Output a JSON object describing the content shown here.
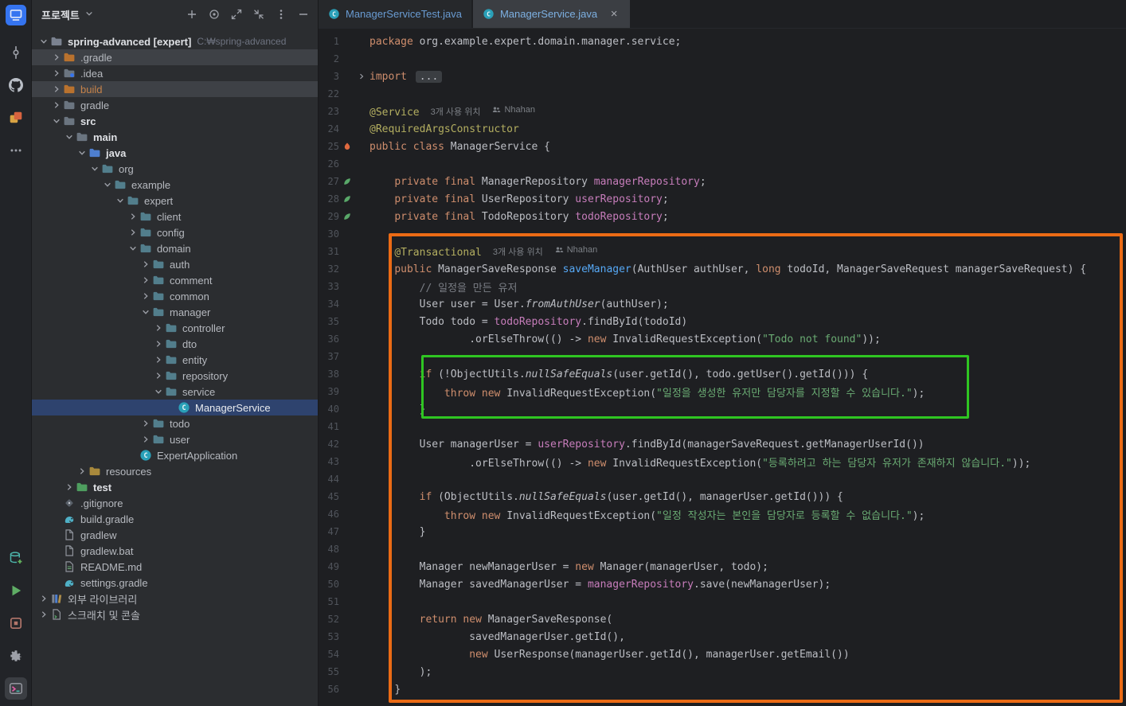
{
  "activity_bar": {
    "top": [
      {
        "name": "app-logo"
      },
      {
        "name": "commit"
      },
      {
        "name": "github"
      },
      {
        "name": "services"
      },
      {
        "name": "more"
      }
    ],
    "bottom": [
      {
        "name": "database-add"
      },
      {
        "name": "run"
      },
      {
        "name": "artifact"
      },
      {
        "name": "settings"
      },
      {
        "name": "terminal",
        "active": true
      }
    ]
  },
  "project_panel": {
    "title": "프로젝트",
    "header_icons": [
      {
        "name": "plus"
      },
      {
        "name": "target"
      },
      {
        "name": "expand"
      },
      {
        "name": "collapse"
      },
      {
        "name": "kebab"
      },
      {
        "name": "hide"
      }
    ],
    "tree": [
      {
        "label": "spring-advanced [expert]",
        "extra": "C:₩spring-advanced",
        "level": 0,
        "chevron": "down",
        "icon": "folder-root",
        "bold": true
      },
      {
        "label": ".gradle",
        "level": 1,
        "chevron": "right",
        "icon": "folder-excluded",
        "row": "hover"
      },
      {
        "label": ".idea",
        "level": 1,
        "chevron": "right",
        "icon": "folder-idea"
      },
      {
        "label": "build",
        "level": 1,
        "chevron": "right",
        "icon": "folder-excluded",
        "row": "hover",
        "label_class": "excluded"
      },
      {
        "label": "gradle",
        "level": 1,
        "chevron": "right",
        "icon": "folder"
      },
      {
        "label": "src",
        "level": 1,
        "chevron": "down",
        "icon": "folder",
        "bold": true
      },
      {
        "label": "main",
        "level": 2,
        "chevron": "down",
        "icon": "folder",
        "bold": true
      },
      {
        "label": "java",
        "level": 3,
        "chevron": "down",
        "icon": "folder-source",
        "bold": true
      },
      {
        "label": "org",
        "level": 4,
        "chevron": "down",
        "icon": "package"
      },
      {
        "label": "example",
        "level": 5,
        "chevron": "down",
        "icon": "package"
      },
      {
        "label": "expert",
        "level": 6,
        "chevron": "down",
        "icon": "package"
      },
      {
        "label": "client",
        "level": 7,
        "chevron": "right",
        "icon": "package"
      },
      {
        "label": "config",
        "level": 7,
        "chevron": "right",
        "icon": "package"
      },
      {
        "label": "domain",
        "level": 7,
        "chevron": "down",
        "icon": "package"
      },
      {
        "label": "auth",
        "level": 8,
        "chevron": "right",
        "icon": "package"
      },
      {
        "label": "comment",
        "level": 8,
        "chevron": "right",
        "icon": "package"
      },
      {
        "label": "common",
        "level": 8,
        "chevron": "right",
        "icon": "package"
      },
      {
        "label": "manager",
        "level": 8,
        "chevron": "down",
        "icon": "package"
      },
      {
        "label": "controller",
        "level": 9,
        "chevron": "right",
        "icon": "package"
      },
      {
        "label": "dto",
        "level": 9,
        "chevron": "right",
        "icon": "package"
      },
      {
        "label": "entity",
        "level": 9,
        "chevron": "right",
        "icon": "package"
      },
      {
        "label": "repository",
        "level": 9,
        "chevron": "right",
        "icon": "package"
      },
      {
        "label": "service",
        "level": 9,
        "chevron": "down",
        "icon": "package"
      },
      {
        "label": "ManagerService",
        "level": 10,
        "chevron": "none",
        "icon": "class",
        "selected": true
      },
      {
        "label": "todo",
        "level": 8,
        "chevron": "right",
        "icon": "package"
      },
      {
        "label": "user",
        "level": 8,
        "chevron": "right",
        "icon": "package"
      },
      {
        "label": "ExpertApplication",
        "level": 7,
        "chevron": "none",
        "icon": "class"
      },
      {
        "label": "resources",
        "level": 3,
        "chevron": "right",
        "icon": "folder-resources"
      },
      {
        "label": "test",
        "level": 2,
        "chevron": "right",
        "icon": "folder-test",
        "bold": true
      },
      {
        "label": ".gitignore",
        "level": 1,
        "chevron": "none",
        "icon": "gitignore"
      },
      {
        "label": "build.gradle",
        "level": 1,
        "chevron": "none",
        "icon": "gradle"
      },
      {
        "label": "gradlew",
        "level": 1,
        "chevron": "none",
        "icon": "file"
      },
      {
        "label": "gradlew.bat",
        "level": 1,
        "chevron": "none",
        "icon": "file"
      },
      {
        "label": "README.md",
        "level": 1,
        "chevron": "none",
        "icon": "readme"
      },
      {
        "label": "settings.gradle",
        "level": 1,
        "chevron": "none",
        "icon": "gradle"
      },
      {
        "label": "외부 라이브러리",
        "level": 0,
        "chevron": "right",
        "icon": "libraries"
      },
      {
        "label": "스크래치 및 콘솔",
        "level": 0,
        "chevron": "right",
        "icon": "scratches"
      }
    ]
  },
  "tabs": [
    {
      "label": "ManagerServiceTest.java",
      "icon": "class",
      "active": false
    },
    {
      "label": "ManagerService.java",
      "icon": "class",
      "active": true,
      "closable": true
    }
  ],
  "editor": {
    "lines": [
      {
        "n": "1",
        "t": [
          [
            "kw",
            "package "
          ],
          [
            "def",
            "org.example.expert.domain.manager.service;"
          ]
        ]
      },
      {
        "n": "2"
      },
      {
        "n": "3",
        "f": true,
        "t": [
          [
            "kw",
            "import "
          ],
          [
            "fold",
            "..."
          ]
        ]
      },
      {
        "n": "22"
      },
      {
        "n": "23",
        "t": [
          [
            "ann",
            "@Service"
          ],
          [
            "inlay",
            "3개 사용 위치"
          ],
          [
            "author",
            "Nhahan"
          ]
        ]
      },
      {
        "n": "24",
        "t": [
          [
            "ann",
            "@RequiredArgsConstructor"
          ]
        ]
      },
      {
        "n": "25",
        "g": "classmark",
        "t": [
          [
            "kw",
            "public class "
          ],
          [
            "def",
            "ManagerService {"
          ]
        ]
      },
      {
        "n": "26"
      },
      {
        "n": "27",
        "g": "bean",
        "t": [
          [
            "ws",
            "    "
          ],
          [
            "kw",
            "private final "
          ],
          [
            "def",
            "ManagerRepository "
          ],
          [
            "field",
            "managerRepository"
          ],
          [
            "def",
            ";"
          ]
        ]
      },
      {
        "n": "28",
        "g": "bean",
        "t": [
          [
            "ws",
            "    "
          ],
          [
            "kw",
            "private final "
          ],
          [
            "def",
            "UserRepository "
          ],
          [
            "field",
            "userRepository"
          ],
          [
            "def",
            ";"
          ]
        ]
      },
      {
        "n": "29",
        "g": "bean",
        "t": [
          [
            "ws",
            "    "
          ],
          [
            "kw",
            "private final "
          ],
          [
            "def",
            "TodoRepository "
          ],
          [
            "field",
            "todoRepository"
          ],
          [
            "def",
            ";"
          ]
        ]
      },
      {
        "n": "30"
      },
      {
        "n": "31",
        "t": [
          [
            "ws",
            "    "
          ],
          [
            "ann",
            "@Transactional"
          ],
          [
            "inlay",
            "3개 사용 위치"
          ],
          [
            "author",
            "Nhahan"
          ]
        ]
      },
      {
        "n": "32",
        "t": [
          [
            "ws",
            "    "
          ],
          [
            "kw",
            "public "
          ],
          [
            "def",
            "ManagerSaveResponse "
          ],
          [
            "mdecl",
            "saveManager"
          ],
          [
            "def",
            "(AuthUser authUser, "
          ],
          [
            "kw",
            "long"
          ],
          [
            "def",
            " todoId, ManagerSaveRequest managerSaveRequest) {"
          ]
        ]
      },
      {
        "n": "33",
        "t": [
          [
            "ws",
            "        "
          ],
          [
            "com",
            "// 일정을 만든 유저"
          ]
        ]
      },
      {
        "n": "34",
        "t": [
          [
            "ws",
            "        "
          ],
          [
            "def",
            "User user = User."
          ],
          [
            "static",
            "fromAuthUser"
          ],
          [
            "def",
            "(authUser);"
          ]
        ]
      },
      {
        "n": "35",
        "t": [
          [
            "ws",
            "        "
          ],
          [
            "def",
            "Todo todo = "
          ],
          [
            "field",
            "todoRepository"
          ],
          [
            "def",
            ".findById(todoId)"
          ]
        ]
      },
      {
        "n": "36",
        "t": [
          [
            "ws",
            "                "
          ],
          [
            "def",
            ".orElseThrow(() -> "
          ],
          [
            "kw",
            "new"
          ],
          [
            "def",
            " InvalidRequestException("
          ],
          [
            "str",
            "\"Todo not found\""
          ],
          [
            "def",
            "));"
          ]
        ]
      },
      {
        "n": "37"
      },
      {
        "n": "38",
        "t": [
          [
            "ws",
            "        "
          ],
          [
            "kw",
            "if"
          ],
          [
            "def",
            " (!ObjectUtils."
          ],
          [
            "static",
            "nullSafeEquals"
          ],
          [
            "def",
            "(user.getId(), todo.getUser().getId())) {"
          ]
        ]
      },
      {
        "n": "39",
        "t": [
          [
            "ws",
            "            "
          ],
          [
            "kw",
            "throw new "
          ],
          [
            "def",
            "InvalidRequestException("
          ],
          [
            "str",
            "\"일정을 생성한 유저만 담당자를 지정할 수 있습니다.\""
          ],
          [
            "def",
            ");"
          ]
        ]
      },
      {
        "n": "40",
        "t": [
          [
            "ws",
            "        "
          ],
          [
            "def",
            "}"
          ]
        ]
      },
      {
        "n": "41"
      },
      {
        "n": "42",
        "t": [
          [
            "ws",
            "        "
          ],
          [
            "def",
            "User managerUser = "
          ],
          [
            "field",
            "userRepository"
          ],
          [
            "def",
            ".findById(managerSaveRequest.getManagerUserId())"
          ]
        ]
      },
      {
        "n": "43",
        "t": [
          [
            "ws",
            "                "
          ],
          [
            "def",
            ".orElseThrow(() -> "
          ],
          [
            "kw",
            "new"
          ],
          [
            "def",
            " InvalidRequestException("
          ],
          [
            "str",
            "\"등록하려고 하는 담당자 유저가 존재하지 않습니다.\""
          ],
          [
            "def",
            "));"
          ]
        ]
      },
      {
        "n": "44"
      },
      {
        "n": "45",
        "t": [
          [
            "ws",
            "        "
          ],
          [
            "kw",
            "if"
          ],
          [
            "def",
            " (ObjectUtils."
          ],
          [
            "static",
            "nullSafeEquals"
          ],
          [
            "def",
            "(user.getId(), managerUser.getId())) {"
          ]
        ]
      },
      {
        "n": "46",
        "t": [
          [
            "ws",
            "            "
          ],
          [
            "kw",
            "throw new "
          ],
          [
            "def",
            "InvalidRequestException("
          ],
          [
            "str",
            "\"일정 작성자는 본인을 담당자로 등록할 수 없습니다.\""
          ],
          [
            "def",
            ");"
          ]
        ]
      },
      {
        "n": "47",
        "t": [
          [
            "ws",
            "        "
          ],
          [
            "def",
            "}"
          ]
        ]
      },
      {
        "n": "48"
      },
      {
        "n": "49",
        "t": [
          [
            "ws",
            "        "
          ],
          [
            "def",
            "Manager newManagerUser = "
          ],
          [
            "kw",
            "new"
          ],
          [
            "def",
            " Manager(managerUser, todo);"
          ]
        ]
      },
      {
        "n": "50",
        "t": [
          [
            "ws",
            "        "
          ],
          [
            "def",
            "Manager savedManagerUser = "
          ],
          [
            "field",
            "managerRepository"
          ],
          [
            "def",
            ".save(newManagerUser);"
          ]
        ]
      },
      {
        "n": "51"
      },
      {
        "n": "52",
        "t": [
          [
            "ws",
            "        "
          ],
          [
            "kw",
            "return new "
          ],
          [
            "def",
            "ManagerSaveResponse("
          ]
        ]
      },
      {
        "n": "53",
        "t": [
          [
            "ws",
            "                "
          ],
          [
            "def",
            "savedManagerUser.getId(),"
          ]
        ]
      },
      {
        "n": "54",
        "t": [
          [
            "ws",
            "                "
          ],
          [
            "kw",
            "new"
          ],
          [
            "def",
            " UserResponse(managerUser.getId(), managerUser.getEmail())"
          ]
        ]
      },
      {
        "n": "55",
        "t": [
          [
            "ws",
            "        "
          ],
          [
            "def",
            ");"
          ]
        ]
      },
      {
        "n": "56",
        "t": [
          [
            "ws",
            "    "
          ],
          [
            "def",
            "}"
          ]
        ]
      }
    ]
  },
  "annotations": {
    "method_box": {
      "color": "#EB6B15"
    },
    "condition_box": {
      "color": "#2FC522"
    }
  },
  "colors": {
    "editor_bg": "#1E1F22",
    "panel_bg": "#2B2D30",
    "selection_blue": "#2E436E",
    "keyword": "#CF8E6D",
    "string": "#6AAB73",
    "annotation_token": "#B3AE60",
    "field_token": "#C77DBB"
  }
}
